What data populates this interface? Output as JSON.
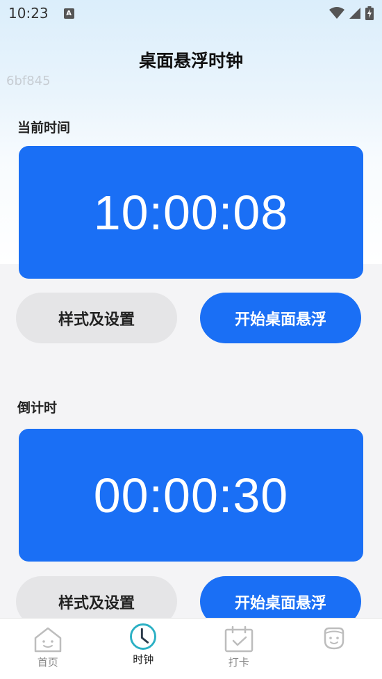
{
  "status_bar": {
    "time": "10:23",
    "app_icon_letter": "A"
  },
  "header": {
    "title": "桌面悬浮时钟",
    "watermark": "6bf845"
  },
  "current_time": {
    "label": "当前时间",
    "time": "10:00:08",
    "settings_button": "样式及设置",
    "float_button": "开始桌面悬浮"
  },
  "countdown": {
    "label": "倒计时",
    "time": "00:00:30",
    "settings_button": "样式及设置",
    "float_button": "开始桌面悬浮"
  },
  "bottom_nav": {
    "items": [
      {
        "label": "首页",
        "icon": "home-icon"
      },
      {
        "label": "时钟",
        "icon": "clock-icon"
      },
      {
        "label": "打卡",
        "icon": "calendar-check-icon"
      },
      {
        "label": "",
        "icon": "face-icon"
      }
    ],
    "active_index": 1
  },
  "colors": {
    "accent": "#1a6ff5",
    "button_grey": "#e5e5e7",
    "active_nav": "#2bb0c4"
  }
}
